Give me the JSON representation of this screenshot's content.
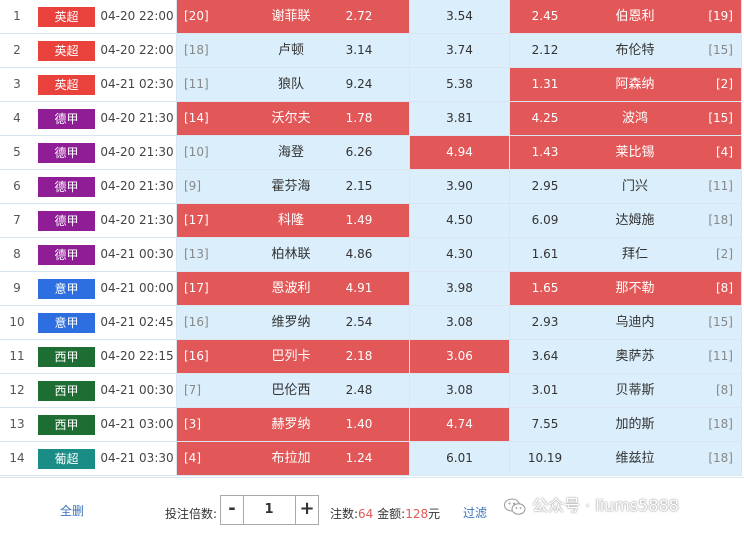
{
  "matches": [
    {
      "idx": "1",
      "league": "英超",
      "league_color": "#e9413b",
      "time": "04-20 22:00",
      "home_rank": "[20]",
      "home": "谢菲联",
      "odd_h": "2.72",
      "odd_d": "3.54",
      "odd_a": "2.45",
      "away": "伯恩利",
      "away_rank": "[19]",
      "sel": [
        true,
        false,
        true
      ]
    },
    {
      "idx": "2",
      "league": "英超",
      "league_color": "#e9413b",
      "time": "04-20 22:00",
      "home_rank": "[18]",
      "home": "卢顿",
      "odd_h": "3.14",
      "odd_d": "3.74",
      "odd_a": "2.12",
      "away": "布伦特",
      "away_rank": "[15]",
      "sel": [
        false,
        false,
        false
      ]
    },
    {
      "idx": "3",
      "league": "英超",
      "league_color": "#e9413b",
      "time": "04-21 02:30",
      "home_rank": "[11]",
      "home": "狼队",
      "odd_h": "9.24",
      "odd_d": "5.38",
      "odd_a": "1.31",
      "away": "阿森纳",
      "away_rank": "[2]",
      "sel": [
        false,
        false,
        true
      ]
    },
    {
      "idx": "4",
      "league": "德甲",
      "league_color": "#8e1d96",
      "time": "04-20 21:30",
      "home_rank": "[14]",
      "home": "沃尔夫",
      "odd_h": "1.78",
      "odd_d": "3.81",
      "odd_a": "4.25",
      "away": "波鸿",
      "away_rank": "[15]",
      "sel": [
        true,
        false,
        true
      ]
    },
    {
      "idx": "5",
      "league": "德甲",
      "league_color": "#8e1d96",
      "time": "04-20 21:30",
      "home_rank": "[10]",
      "home": "海登",
      "odd_h": "6.26",
      "odd_d": "4.94",
      "odd_a": "1.43",
      "away": "莱比锡",
      "away_rank": "[4]",
      "sel": [
        false,
        true,
        true
      ]
    },
    {
      "idx": "6",
      "league": "德甲",
      "league_color": "#8e1d96",
      "time": "04-20 21:30",
      "home_rank": "[9]",
      "home": "霍芬海",
      "odd_h": "2.15",
      "odd_d": "3.90",
      "odd_a": "2.95",
      "away": "门兴",
      "away_rank": "[11]",
      "sel": [
        false,
        false,
        false
      ]
    },
    {
      "idx": "7",
      "league": "德甲",
      "league_color": "#8e1d96",
      "time": "04-20 21:30",
      "home_rank": "[17]",
      "home": "科隆",
      "odd_h": "1.49",
      "odd_d": "4.50",
      "odd_a": "6.09",
      "away": "达姆施",
      "away_rank": "[18]",
      "sel": [
        true,
        false,
        false
      ]
    },
    {
      "idx": "8",
      "league": "德甲",
      "league_color": "#8e1d96",
      "time": "04-21 00:30",
      "home_rank": "[13]",
      "home": "柏林联",
      "odd_h": "4.86",
      "odd_d": "4.30",
      "odd_a": "1.61",
      "away": "拜仁",
      "away_rank": "[2]",
      "sel": [
        false,
        false,
        false
      ]
    },
    {
      "idx": "9",
      "league": "意甲",
      "league_color": "#2d6fe0",
      "time": "04-21 00:00",
      "home_rank": "[17]",
      "home": "恩波利",
      "odd_h": "4.91",
      "odd_d": "3.98",
      "odd_a": "1.65",
      "away": "那不勒",
      "away_rank": "[8]",
      "sel": [
        true,
        false,
        true
      ]
    },
    {
      "idx": "10",
      "league": "意甲",
      "league_color": "#2d6fe0",
      "time": "04-21 02:45",
      "home_rank": "[16]",
      "home": "维罗纳",
      "odd_h": "2.54",
      "odd_d": "3.08",
      "odd_a": "2.93",
      "away": "乌迪内",
      "away_rank": "[15]",
      "sel": [
        false,
        false,
        false
      ]
    },
    {
      "idx": "11",
      "league": "西甲",
      "league_color": "#1e6e33",
      "time": "04-20 22:15",
      "home_rank": "[16]",
      "home": "巴列卡",
      "odd_h": "2.18",
      "odd_d": "3.06",
      "odd_a": "3.64",
      "away": "奥萨苏",
      "away_rank": "[11]",
      "sel": [
        true,
        true,
        false
      ]
    },
    {
      "idx": "12",
      "league": "西甲",
      "league_color": "#1e6e33",
      "time": "04-21 00:30",
      "home_rank": "[7]",
      "home": "巴伦西",
      "odd_h": "2.48",
      "odd_d": "3.08",
      "odd_a": "3.01",
      "away": "贝蒂斯",
      "away_rank": "[8]",
      "sel": [
        false,
        false,
        false
      ]
    },
    {
      "idx": "13",
      "league": "西甲",
      "league_color": "#1e6e33",
      "time": "04-21 03:00",
      "home_rank": "[3]",
      "home": "赫罗纳",
      "odd_h": "1.40",
      "odd_d": "4.74",
      "odd_a": "7.55",
      "away": "加的斯",
      "away_rank": "[18]",
      "sel": [
        true,
        true,
        false
      ]
    },
    {
      "idx": "14",
      "league": "葡超",
      "league_color": "#1a8d86",
      "time": "04-21 03:30",
      "home_rank": "[4]",
      "home": "布拉加",
      "odd_h": "1.24",
      "odd_d": "6.01",
      "odd_a": "10.19",
      "away": "维兹拉",
      "away_rank": "[18]",
      "sel": [
        true,
        false,
        false
      ]
    }
  ],
  "footer": {
    "clear_label": "全删",
    "multiplier_label": "投注倍数:",
    "minus": "-",
    "multiplier_value": "1",
    "plus": "+",
    "count_label": "注数:",
    "count_value": "64",
    "amount_label": " 金额:",
    "amount_value": "128",
    "amount_unit": "元",
    "filter_label": "过滤"
  },
  "watermark": "公众号 · liums5888"
}
